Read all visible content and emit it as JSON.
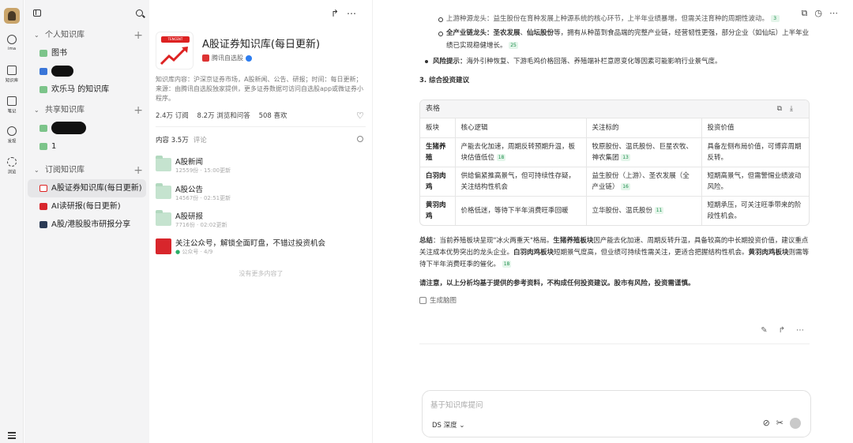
{
  "rail": {
    "items": [
      {
        "label": "ima"
      },
      {
        "label": "知识库"
      },
      {
        "label": "笔记"
      },
      {
        "label": "发现"
      },
      {
        "label": "浏览"
      }
    ]
  },
  "sidebar": {
    "sections": [
      {
        "title": "个人知识库",
        "items": [
          "图书",
          "",
          "欢乐马 的知识库"
        ]
      },
      {
        "title": "共享知识库",
        "items": [
          "",
          "1"
        ]
      },
      {
        "title": "订阅知识库",
        "items": [
          "A股证券知识库(每日更新)",
          "AI读研报(每日更新)",
          "A股/港股股市研报分享"
        ]
      }
    ]
  },
  "kb": {
    "cover_text": "TENCENT",
    "title": "A股证券知识库(每日更新)",
    "publisher": "腾讯自选股",
    "desc": "知识库内容：沪深京证券市场，A股新闻、公告、研报；时间：每日更新；来源：由腾讯自选股独家提供，更多证券数据可访问自选股app或微证券小程序。",
    "stats": {
      "subs": "2.4万 订阅",
      "views": "8.2万 浏览和问答",
      "likes": "508 喜欢"
    },
    "tab_content": "内容 3.5万",
    "tab_comments": "评论",
    "items": [
      {
        "name": "A股新闻",
        "meta": "12559份 · 15:00更新"
      },
      {
        "name": "A股公告",
        "meta": "14567份 · 02:51更新"
      },
      {
        "name": "A股研报",
        "meta": "7716份 · 02:02更新"
      },
      {
        "name": "关注公众号，解锁全面盯盘，不错过投资机会",
        "meta": "公众号 · 4/9"
      }
    ],
    "no_more": "没有更多内容了"
  },
  "answer": {
    "cut_line": "上游种源龙头：益生股份在育种发展上种源系统的核心环节，上半年业绩暴增。但需关注育种的周期性波动。",
    "cut_ref": "3",
    "bullet2_a": "全产业链龙头：",
    "bullet2_b": "圣农发展",
    "bullet2_sep": "、",
    "bullet2_c": "仙坛股份",
    "bullet2_d": "等，拥有从种苗到食品端的完整产业链，经营韧性更强，部分企业（如仙坛）上半年业绩已实现稳健增长。",
    "bullet2_ref": "25",
    "risk_label": "风险提示：",
    "risk_text": "海外引种恢复、下游毛鸡价格回落、养殖端补栏意愿变化等因素可能影响行业景气度。",
    "heading": "3. 综合投资建议",
    "table": {
      "label": "表格",
      "headers": [
        "板块",
        "核心逻辑",
        "关注标的",
        "投资价值"
      ],
      "rows": [
        {
          "sector": "生猪养殖",
          "logic": "产能去化加速，周期反转预期升温，板块估值低位",
          "logic_ref": "18",
          "targets": "牧原股份、温氏股份、巨星农牧、神农集团",
          "targets_ref": "13",
          "value": "具备左侧布局价值，可博弈周期反转。"
        },
        {
          "sector": "白羽肉鸡",
          "logic": "供给偏紧推高景气，但可持续性存疑，关注结构性机会",
          "logic_ref": "",
          "targets": "益生股份（上游）、圣农发展（全产业链）",
          "targets_ref": "16",
          "value": "短期高景气，但需警惕业绩波动风险。"
        },
        {
          "sector": "黄羽肉鸡",
          "logic": "价格低迷，等待下半年消费旺季回暖",
          "logic_ref": "",
          "targets": "立华股份、温氏股份",
          "targets_ref": "11",
          "value": "短期承压，可关注旺季带来的阶段性机会。"
        }
      ]
    },
    "summary": {
      "label": "总结",
      "t1": "：当前养殖板块呈现\"冰火两重天\"格局。",
      "b1": "生猪养殖板块",
      "t2": "因产能去化加速、周期反转升温，具备较高的中长期投资价值，建议重点关注成本优势突出的龙头企业。",
      "b2": "白羽肉鸡板块",
      "t3": "短期景气度高，但业绩可持续性需关注，更适合把握结构性机会。",
      "b3": "黄羽肉鸡板块",
      "t4": "则需等待下半年消费旺季的催化。",
      "ref": "18"
    },
    "disclaimer": "请注意，以上分析均基于提供的参考资料，不构成任何投资建议。股市有风险，投资需谨慎。",
    "mindmap": "生成脑图"
  },
  "input": {
    "placeholder": "基于知识库提问",
    "model": "DS 深度"
  },
  "colors": {
    "accent_green": "#2aae67",
    "brand_red": "#d8262c"
  }
}
